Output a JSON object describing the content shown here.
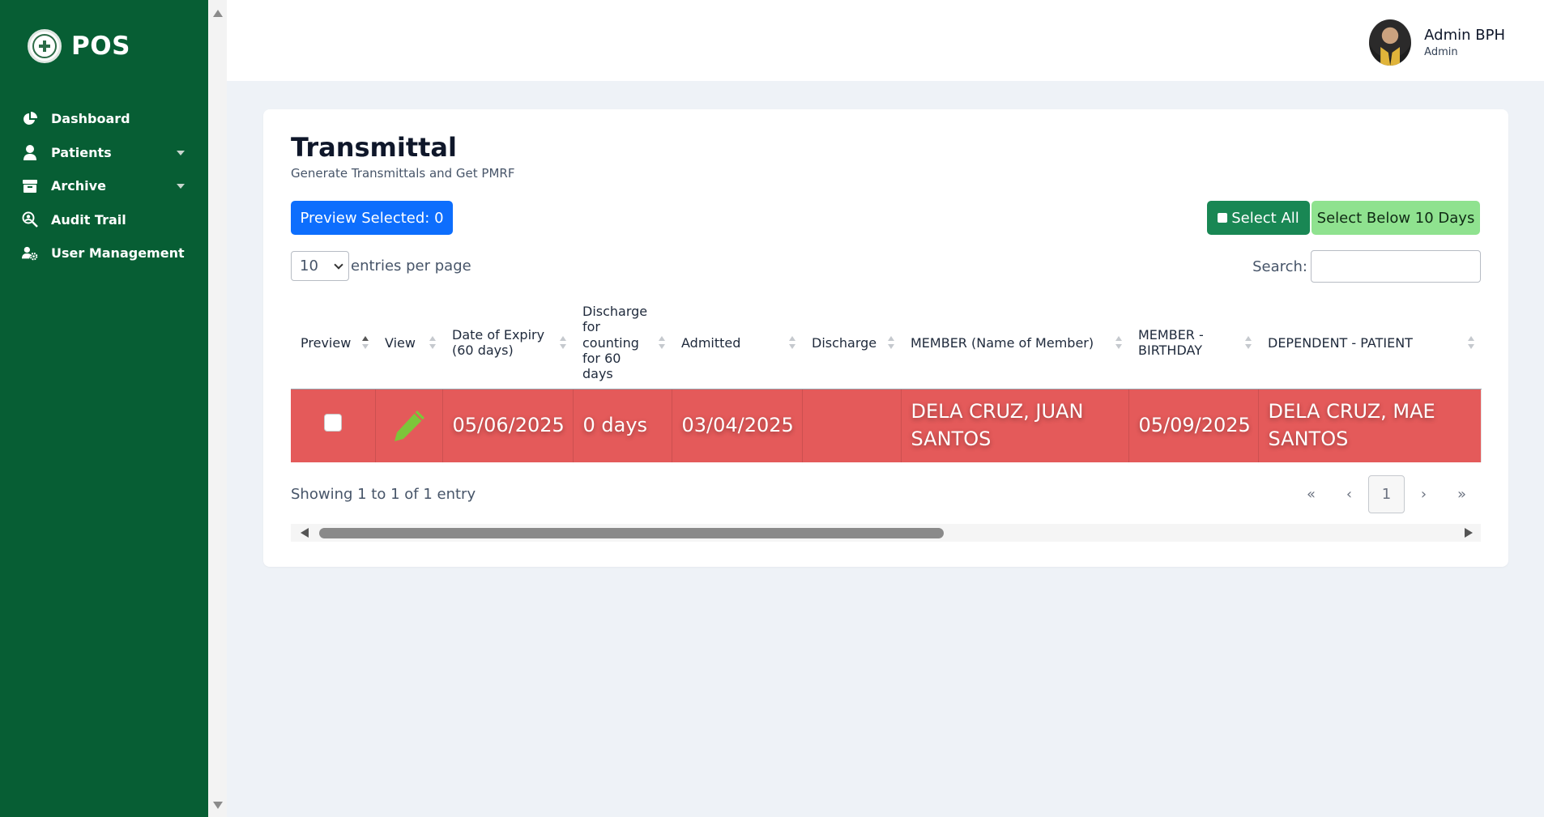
{
  "brand": {
    "name": "POS"
  },
  "sidebar": {
    "items": [
      {
        "label": "Dashboard",
        "icon": "chart-pie-icon"
      },
      {
        "label": "Patients",
        "icon": "user-icon"
      },
      {
        "label": "Archive",
        "icon": "archive-box-icon"
      },
      {
        "label": "Audit Trail",
        "icon": "search-user-icon"
      },
      {
        "label": "User Management",
        "icon": "users-gear-icon"
      }
    ]
  },
  "user": {
    "name": "Admin BPH",
    "role": "Admin"
  },
  "page": {
    "title": "Transmittal",
    "subtitle": "Generate Transmittals and Get PMRF"
  },
  "buttons": {
    "preview_selected": "Preview Selected: 0",
    "select_all": "Select All",
    "select_below": "Select Below 10 Days"
  },
  "entries": {
    "value": "10",
    "label": "entries per page"
  },
  "search": {
    "label": "Search:",
    "value": "",
    "placeholder": ""
  },
  "table": {
    "headers": [
      "Preview",
      "View",
      "Date of Expiry (60 days)",
      "Discharge for counting for 60 days",
      "Admitted",
      "Discharge",
      "MEMBER (Name of Member)",
      "MEMBER - BIRTHDAY",
      "DEPENDENT - PATIENT"
    ],
    "rows": [
      {
        "date_of_expiry": "05/06/2025",
        "discharge_counting": "0 days",
        "admitted": "03/04/2025",
        "discharge": "",
        "member_name": "DELA CRUZ, JUAN SANTOS",
        "member_birthday": "05/09/2025",
        "dependent_patient": "DELA CRUZ, MAE SANTOS"
      }
    ]
  },
  "footer": {
    "showing": "Showing 1 to 1 of 1 entry"
  },
  "pagination": {
    "first": "«",
    "prev": "‹",
    "current": "1",
    "next": "›",
    "last": "»"
  },
  "colors": {
    "sidebar": "#075e34",
    "row_highlight": "#e45a5a",
    "primary": "#0d6efd",
    "success": "#198754",
    "light_green": "#8fe28f"
  }
}
